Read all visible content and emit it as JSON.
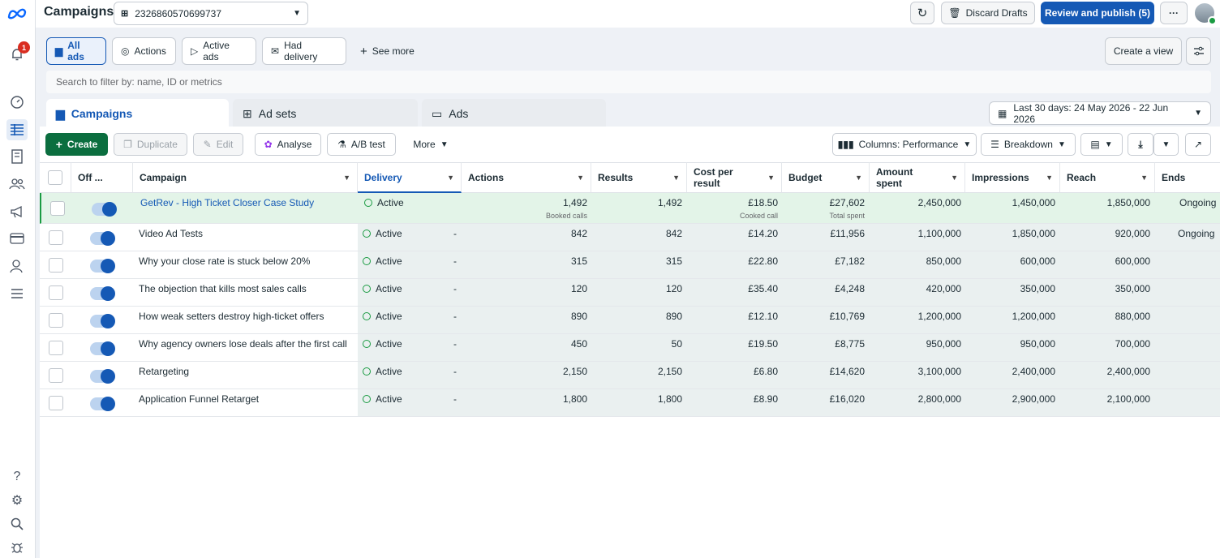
{
  "topbar": {
    "title": "Campaigns",
    "account_id": "2326860570699737",
    "discard": "Discard Drafts",
    "publish": "Review and publish (5)",
    "more": "···"
  },
  "rail": {
    "notification_count": "1"
  },
  "filters": {
    "chips": [
      "All ads",
      "Actions",
      "Active ads",
      "Had delivery",
      "See more"
    ],
    "create_view": "Create a view",
    "search_placeholder": "Search to filter by: name, ID or metrics"
  },
  "tabs": [
    "Campaigns",
    "Ad sets",
    "Ads"
  ],
  "date_range": "Last 30 days: 24 May 2026 - 22 Jun 2026",
  "toolbar": {
    "create": "Create",
    "duplicate": "Duplicate",
    "edit": "Edit",
    "analyse": "Analyse",
    "ab_test": "A/B test",
    "more": "More",
    "columns": "Columns: Performance",
    "breakdown": "Breakdown"
  },
  "columns": {
    "off": "Off ...",
    "campaign": "Campaign",
    "delivery": "Delivery",
    "actions": "Actions",
    "results": "Results",
    "cost_per_result": "Cost per result",
    "budget": "Budget",
    "amount_spent": "Amount spent",
    "impressions": "Impressions",
    "reach": "Reach",
    "ends": "Ends"
  },
  "rows": [
    {
      "name": "GetRev - High Ticket Closer Case Study",
      "delivery": "Active",
      "actions": "1,492",
      "actions_sub": "Booked calls",
      "results": "1,492",
      "cpr": "£18.50",
      "cpr_sub": "Cooked call",
      "budget": "£27,602",
      "budget_sub": "Total spent",
      "spent": "2,450,000",
      "impressions": "1,450,000",
      "reach": "1,850,000",
      "ends": "Ongoing"
    },
    {
      "name": "Video Ad Tests",
      "delivery": "Active",
      "actions": "842",
      "results": "842",
      "cpr": "£14.20",
      "budget": "£11,956",
      "spent": "1,100,000",
      "impressions": "1,850,000",
      "reach": "920,000",
      "ends": "Ongoing"
    },
    {
      "name": "Why your close rate is stuck below 20%",
      "delivery": "Active",
      "actions": "315",
      "results": "315",
      "cpr": "£22.80",
      "budget": "£7,182",
      "spent": "850,000",
      "impressions": "600,000",
      "reach": "600,000",
      "ends": ""
    },
    {
      "name": "The objection that kills most sales calls",
      "delivery": "Active",
      "actions": "120",
      "results": "120",
      "cpr": "£35.40",
      "budget": "£4,248",
      "spent": "420,000",
      "impressions": "350,000",
      "reach": "350,000",
      "ends": ""
    },
    {
      "name": "How weak setters destroy high-ticket offers",
      "delivery": "Active",
      "actions": "890",
      "results": "890",
      "cpr": "£12.10",
      "budget": "£10,769",
      "spent": "1,200,000",
      "impressions": "1,200,000",
      "reach": "880,000",
      "ends": ""
    },
    {
      "name": "Why agency owners lose deals after the first call",
      "delivery": "Active",
      "actions": "450",
      "results": "50",
      "cpr": "£19.50",
      "budget": "£8,775",
      "spent": "950,000",
      "impressions": "950,000",
      "reach": "700,000",
      "ends": ""
    },
    {
      "name": "Retargeting",
      "delivery": "Active",
      "actions": "2,150",
      "results": "2,150",
      "cpr": "£6.80",
      "budget": "£14,620",
      "spent": "3,100,000",
      "impressions": "2,400,000",
      "reach": "2,400,000",
      "ends": ""
    },
    {
      "name": "Application Funnel Retarget",
      "delivery": "Active",
      "actions": "1,800",
      "results": "1,800",
      "cpr": "£8.90",
      "budget": "£16,020",
      "spent": "2,800,000",
      "impressions": "2,900,000",
      "reach": "2,100,000",
      "ends": ""
    }
  ],
  "row_dash": "-",
  "colors": {
    "accent": "#1559b5",
    "create": "#0b6e3f",
    "active": "#1a9b42"
  }
}
